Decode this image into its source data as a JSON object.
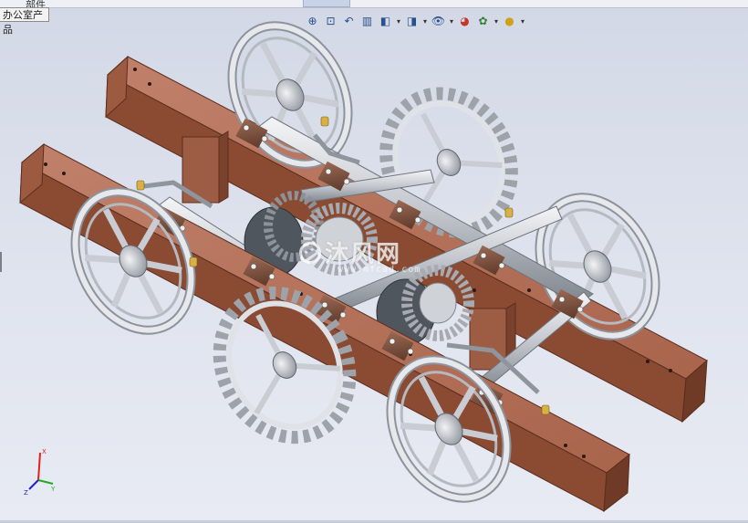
{
  "top_tabs": [
    {
      "label": "部件"
    }
  ],
  "tab_label": "办公室产品",
  "headsup_toolbar": [
    {
      "icon": "zoom-to-fit-icon",
      "glyph": "⊕"
    },
    {
      "icon": "zoom-area-icon",
      "glyph": "⊡"
    },
    {
      "icon": "previous-view-icon",
      "glyph": "↶"
    },
    {
      "icon": "section-view-icon",
      "glyph": "▥"
    },
    {
      "icon": "view-orientation-icon",
      "glyph": "◧",
      "dropdown": true
    },
    {
      "icon": "display-style-icon",
      "glyph": "◨",
      "dropdown": true
    },
    {
      "icon": "hide-show-items-icon",
      "glyph": "👁",
      "dropdown": true
    },
    {
      "icon": "edit-appearance-icon",
      "glyph": "◕"
    },
    {
      "icon": "apply-scene-icon",
      "glyph": "✿",
      "dropdown": true
    },
    {
      "icon": "view-settings-icon",
      "glyph": "●",
      "dropdown": true
    }
  ],
  "triad": {
    "x": "X",
    "y": "Y",
    "z": "Z"
  },
  "watermark": {
    "text": "沐风网",
    "url": "www.mfcad.com"
  },
  "colors": {
    "beam_top": "#b6705a",
    "beam_side": "#8a4b32",
    "beam_end": "#6f3a26",
    "metal": "#d6d9de",
    "metal_dark": "#8d939c",
    "gear": "#a7aab0",
    "brass": "#d7b046"
  }
}
